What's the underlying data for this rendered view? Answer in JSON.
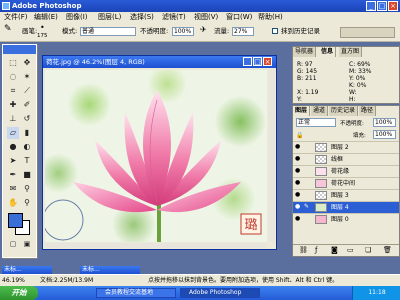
{
  "app": {
    "title": "Adobe Photoshop"
  },
  "menus": [
    "文件(F)",
    "编辑(E)",
    "图像(I)",
    "图层(L)",
    "选择(S)",
    "滤镜(T)",
    "视图(V)",
    "窗口(W)",
    "帮助(H)"
  ],
  "options": {
    "brush_label": "画笔:",
    "brush_size": "175",
    "mode_label": "模式:",
    "mode_value": "普通",
    "opacity_label": "不透明度:",
    "opacity_value": "100%",
    "flow_label": "流量:",
    "flow_value": "27%",
    "history_label": "抹到历史记录"
  },
  "document": {
    "title": "荷花.jpg @ 46.2%(图层 4, RGB)",
    "seal_text": "璐"
  },
  "info_panel": {
    "tabs": [
      "导航器",
      "信息",
      "直方图"
    ],
    "r_label": "R:",
    "r_value": "97",
    "g_label": "G:",
    "g_value": "145",
    "b_label": "B:",
    "b_value": "211",
    "c_label": "C:",
    "c_value": "69%",
    "m_label": "M:",
    "m_value": "33%",
    "y_label": "Y:",
    "y_value": "0%",
    "k_label": "K:",
    "k_value": "0%",
    "x_label": "X:",
    "x_value": "1.19",
    "y2_label": "Y:",
    "y2_value": "",
    "w_label": "W:",
    "h_label": "H:"
  },
  "layers_panel": {
    "tabs": [
      "图层",
      "通道",
      "历史记录",
      "路径"
    ],
    "blend_mode": "正常",
    "opacity_label": "不透明度:",
    "opacity_value": "100%",
    "fill_label": "填充:",
    "fill_value": "100%",
    "layers": [
      {
        "name": "图层 2",
        "selected": false
      },
      {
        "name": "线框",
        "selected": false
      },
      {
        "name": "荷花缘",
        "selected": false
      },
      {
        "name": "荷花中间",
        "selected": false
      },
      {
        "name": "图层 3",
        "selected": false
      },
      {
        "name": "图层 4",
        "selected": true
      },
      {
        "name": "图层 0",
        "selected": false
      }
    ]
  },
  "status": {
    "zoom": "46.19%",
    "doc_size": "文档:2.25M/13.9M",
    "hint": "点按并拖移以抹到背景色。要用附加选项，使用 Shift、Alt 和 Ctrl 键。"
  },
  "minimized": [
    "未标...",
    "未标..."
  ],
  "taskbar": {
    "start_label": "开始",
    "items": [
      "会员教程交流基地",
      "Adobe Photoshop"
    ],
    "clock": "11:18"
  },
  "colors": {
    "foreground": "#3a6fd8",
    "background": "#ffffff",
    "accent": "#2b5fd3"
  }
}
